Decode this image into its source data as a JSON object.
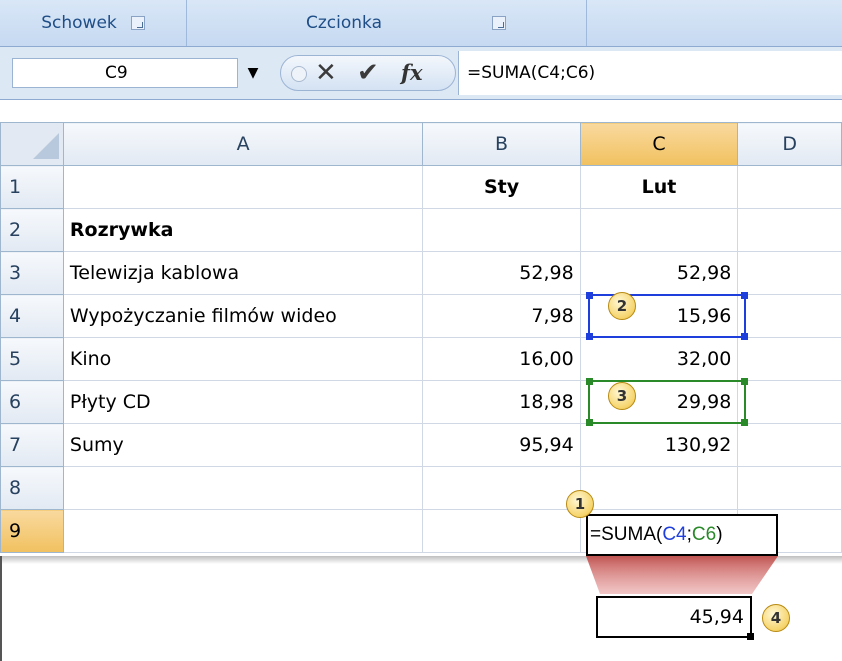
{
  "ribbon": {
    "clipboard_label": "Schowek",
    "font_label": "Czcionka"
  },
  "formula_bar": {
    "name_box": "C9",
    "formula": "=SUMA(C4;C6)"
  },
  "columns": [
    "A",
    "B",
    "C",
    "D"
  ],
  "rows": [
    {
      "num": "1",
      "a": "",
      "b": "Sty",
      "c": "Lut"
    },
    {
      "num": "2",
      "a": "Rozrywka",
      "b": "",
      "c": ""
    },
    {
      "num": "3",
      "a": "Telewizja kablowa",
      "b": "52,98",
      "c": "52,98"
    },
    {
      "num": "4",
      "a": "Wypożyczanie filmów wideo",
      "b": "7,98",
      "c": "15,96"
    },
    {
      "num": "5",
      "a": "Kino",
      "b": "16,00",
      "c": "32,00"
    },
    {
      "num": "6",
      "a": "Płyty CD",
      "b": "18,98",
      "c": "29,98"
    },
    {
      "num": "7",
      "a": "Sumy",
      "b": "95,94",
      "c": "130,92"
    },
    {
      "num": "8",
      "a": "",
      "b": "",
      "c": ""
    },
    {
      "num": "9",
      "a": "",
      "b": "",
      "c": ""
    }
  ],
  "edit_cell": {
    "prefix": "=SUMA(",
    "ref1": "C4",
    "sep": ";",
    "ref2": "C6",
    "suffix": ")"
  },
  "result": "45,94",
  "callouts": [
    "1",
    "2",
    "3",
    "4"
  ],
  "colors": {
    "ref_blue": "#1f3fdc",
    "ref_green": "#2a8a2a",
    "arrow_red": "#c0504d"
  }
}
